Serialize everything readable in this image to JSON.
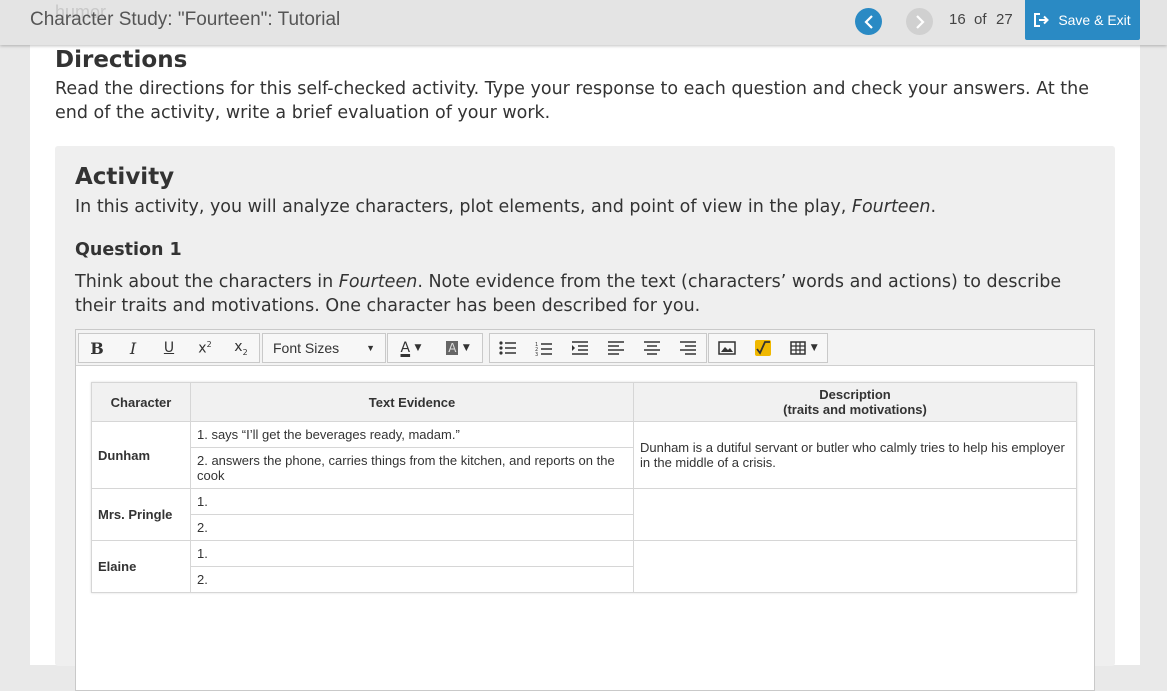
{
  "header": {
    "ghost_text": "humor",
    "title": "Character Study: \"Fourteen\": Tutorial",
    "page_current": "16",
    "page_of": "of",
    "page_total": "27",
    "save_label": "Save & Exit"
  },
  "directions": {
    "heading": "Directions",
    "text": "Read the directions for this self-checked activity. Type your response to each question and check your answers. At the end of the activity, write a brief evaluation of your work."
  },
  "activity": {
    "heading": "Activity",
    "intro": "In this activity, you will analyze characters, plot elements, and point of view in the play, ",
    "intro_title": "Fourteen",
    "intro_end": "."
  },
  "question": {
    "heading": "Question 1",
    "text_a": "Think about the characters in ",
    "text_title": "Fourteen",
    "text_b": ". Note evidence from the text (characters’ words and actions) to describe their traits and motivations. One character has been described for you."
  },
  "toolbar": {
    "font_sizes_label": "Font Sizes",
    "buttons": [
      "bold-icon",
      "italic-icon",
      "underline-icon",
      "superscript-icon",
      "subscript-icon",
      "text-color-icon",
      "highlight-color-icon",
      "bullet-list-icon",
      "numbered-list-icon",
      "indent-icon",
      "align-left-icon",
      "align-center-icon",
      "align-right-icon",
      "image-icon",
      "math-icon",
      "table-icon"
    ]
  },
  "table": {
    "headers": [
      "Character",
      "Text Evidence",
      "Description",
      "(traits and motivations)"
    ],
    "rows": [
      {
        "character": "Dunham",
        "evidence": [
          "1. says “I’ll get the beverages ready, madam.”",
          "2. answers the phone, carries things from the kitchen, and reports on the cook"
        ],
        "description": "Dunham is a dutiful servant or butler who calmly tries to help his employer in the middle of a crisis."
      },
      {
        "character": "Mrs. Pringle",
        "evidence": [
          "1.",
          "2."
        ],
        "description": ""
      },
      {
        "character": "Elaine",
        "evidence": [
          "1.",
          "2."
        ],
        "description": ""
      }
    ]
  },
  "colors": {
    "accent": "#2a8ac4",
    "math_icon": "#f0b800"
  }
}
